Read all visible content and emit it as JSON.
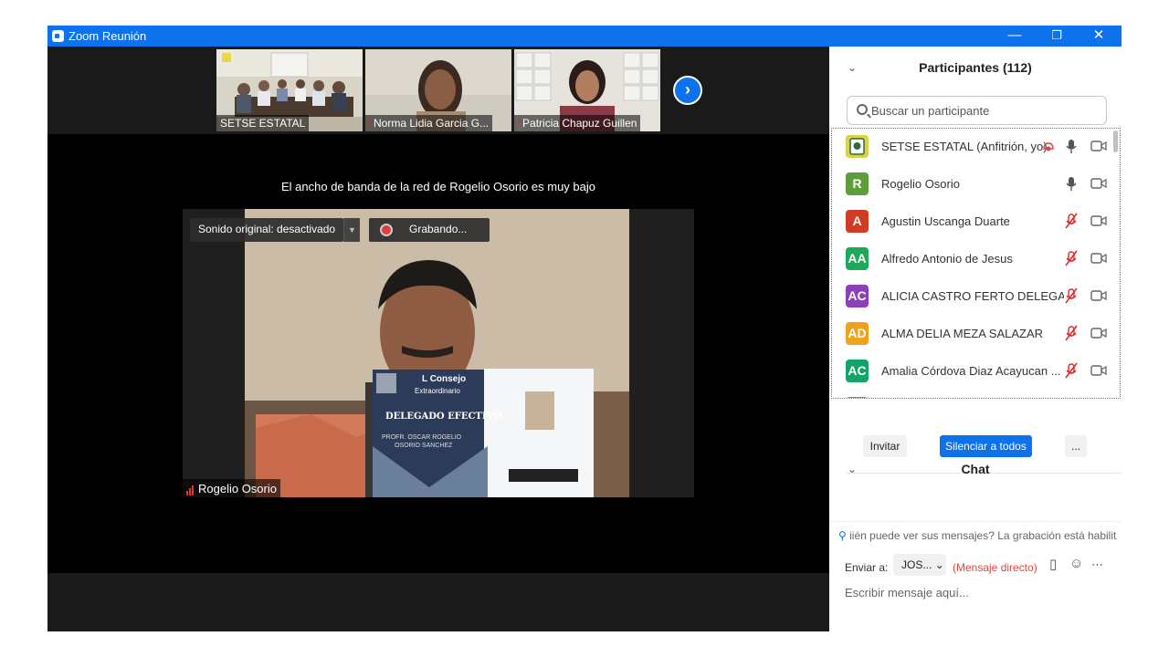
{
  "window": {
    "title": "Zoom Reunión",
    "minimize": "—",
    "restore": "❐",
    "close": "✕"
  },
  "video": {
    "thumbnails": [
      {
        "name": "SETSE ESTATAL",
        "muted": false
      },
      {
        "name": "Norma Lidia Garcia G...",
        "muted": true
      },
      {
        "name": "Patricia Chapuz Guillen",
        "muted": true
      }
    ],
    "next_icon": "chevron-right-icon",
    "bandwidth_notice": "El ancho de banda de la red de Rogelio Osorio es muy bajo",
    "original_sound": "Sonido original: desactivado",
    "recording": "Grabando...",
    "active_speaker": "Rogelio Osorio",
    "card": {
      "header_line1": "L Consejo",
      "header_line2": "Extraordinario",
      "title": "DELEGADO EFECTIVO",
      "name_line1": "PROFR. OSCAR ROGELIO",
      "name_line2": "OSORIO SANCHEZ"
    }
  },
  "participants": {
    "title": "Participantes (112)",
    "search_placeholder": "Buscar un participante",
    "list": [
      {
        "initials": "",
        "name": "SETSE ESTATAL (Anfitrión, yo)",
        "color": "#d9d24a",
        "mic": "on",
        "recording": true
      },
      {
        "initials": "R",
        "name": "Rogelio Osorio",
        "color": "#5d9e3b",
        "mic": "on",
        "recording": false
      },
      {
        "initials": "A",
        "name": "Agustin Uscanga Duarte",
        "color": "#cf3b23",
        "mic": "muted",
        "recording": false
      },
      {
        "initials": "AA",
        "name": "Alfredo Antonio de Jesus",
        "color": "#1ea85a",
        "mic": "muted",
        "recording": false
      },
      {
        "initials": "AC",
        "name": "ALICIA CASTRO FERTO DELEGAC...",
        "color": "#8b3fb8",
        "mic": "muted",
        "recording": false
      },
      {
        "initials": "AD",
        "name": "ALMA DELIA MEZA SALAZAR",
        "color": "#f0a11e",
        "mic": "muted",
        "recording": false
      },
      {
        "initials": "AC",
        "name": "Amalia Córdova Diaz Acayucan ...",
        "color": "#12a56a",
        "mic": "muted",
        "recording": false
      }
    ],
    "invite": "Invitar",
    "mute_all": "Silenciar a todos",
    "more": "..."
  },
  "chat": {
    "title": "Chat",
    "notice": "iién puede ver sus mensajes? La grabación está habilit",
    "send_to_label": "Enviar a:",
    "send_to_value": "JOS...",
    "direct_message": "(Mensaje directo)",
    "input_placeholder": "Escribir mensaje aquí..."
  },
  "colors": {
    "accent": "#0e72ed",
    "muted_red": "#e02828",
    "direct_red": "#e04545"
  }
}
